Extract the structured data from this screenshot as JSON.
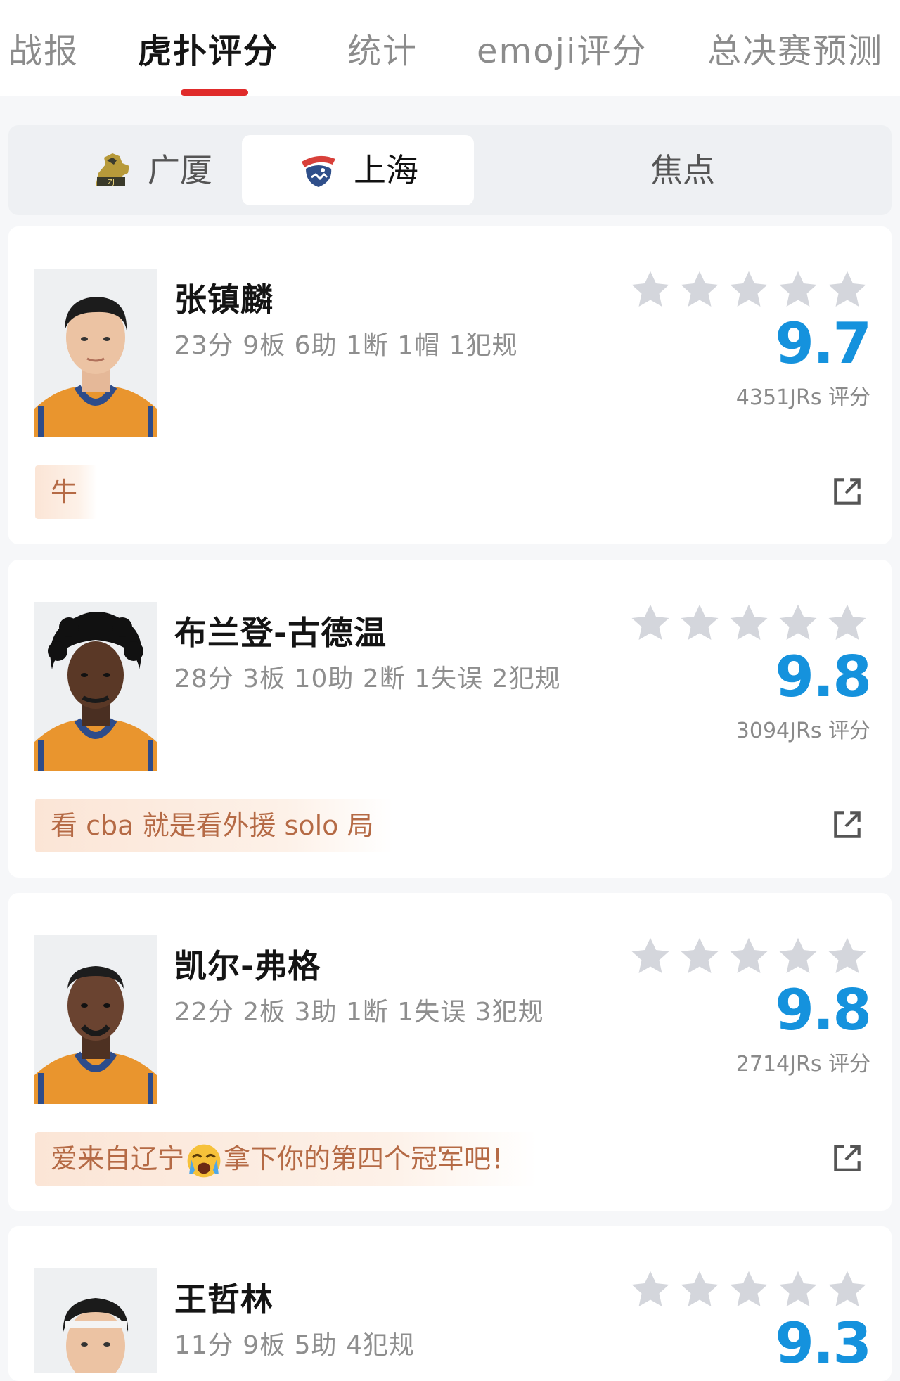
{
  "tabs": [
    "战报",
    "虎扑评分",
    "统计",
    "emoji评分",
    "总决赛预测"
  ],
  "active_tab": "虎扑评分",
  "team_tabs": {
    "home": "广厦",
    "away": "上海",
    "focus": "焦点"
  },
  "accent_color": "#e02b2b",
  "score_color": "#1592dd",
  "players": [
    {
      "name": "张镇麟",
      "stats": "23分 9板 6助 1断 1帽 1犯规",
      "score": "9.7",
      "raters": "4351JRs 评分",
      "comment": "牛",
      "stars": 5
    },
    {
      "name": "布兰登-古德温",
      "stats": "28分 3板 10助 2断 1失误 2犯规",
      "score": "9.8",
      "raters": "3094JRs 评分",
      "comment": "看 cba 就是看外援 solo 局",
      "stars": 5
    },
    {
      "name": "凯尔-弗格",
      "stats": "22分 2板 3助 1断 1失误 3犯规",
      "score": "9.8",
      "raters": "2714JRs 评分",
      "comment_before": "爱来自辽宁",
      "comment_emoji": "crying-face-emoji",
      "comment_after": "拿下你的第四个冠军吧！",
      "stars": 5
    },
    {
      "name": "王哲林",
      "stats": "11分 9板 5助 4犯规",
      "score": "9.3",
      "stars": 5
    }
  ]
}
